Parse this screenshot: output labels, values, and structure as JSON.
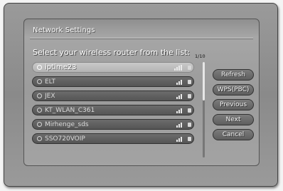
{
  "dialog": {
    "title": "Network Settings",
    "prompt": "Select your wireless router from the list:",
    "page_indicator": "1/10"
  },
  "networks": [
    {
      "name": "iptime23",
      "selected": true,
      "signal_bars": 4
    },
    {
      "name": "ELT",
      "selected": false,
      "signal_bars": 4
    },
    {
      "name": "JEX",
      "selected": false,
      "signal_bars": 4
    },
    {
      "name": "KT_WLAN_C361",
      "selected": false,
      "signal_bars": 3
    },
    {
      "name": "Mirhenge_sds",
      "selected": false,
      "signal_bars": 3
    },
    {
      "name": "SSO720VOIP",
      "selected": false,
      "signal_bars": 3
    }
  ],
  "buttons": {
    "refresh": "Refresh",
    "wps": "WPS(PBC)",
    "previous": "Previous",
    "next": "Next",
    "cancel": "Cancel"
  },
  "colors": {
    "frame": "#8a8a8a",
    "dialog": "#a0a0a0",
    "row": "#5a5a5a",
    "row_selected": "#bdbdbd",
    "button": "#6a6a6a"
  },
  "icons": {
    "radio": "radio-icon",
    "lock": "lock-icon",
    "signal": "signal-strength-icon"
  }
}
